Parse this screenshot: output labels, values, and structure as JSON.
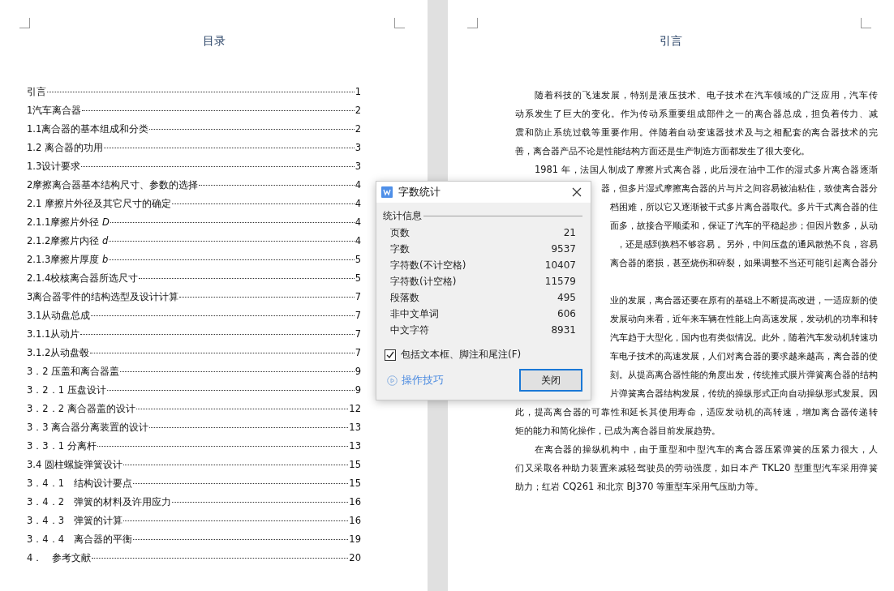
{
  "left_page": {
    "title": "目录",
    "toc": [
      {
        "title": "引言",
        "page": "1"
      },
      {
        "title": "1汽车离合器",
        "page": "2"
      },
      {
        "title": "1.1离合器的基本组成和分类",
        "page": "2"
      },
      {
        "title": "1.2 离合器的功用",
        "page": "3"
      },
      {
        "title": "1.3设计要求",
        "page": "3"
      },
      {
        "title": "2摩擦离合器基本结构尺寸、参数的选择",
        "page": "4"
      },
      {
        "title": "2.1 摩擦片外径及其它尺寸的确定",
        "page": "4"
      },
      {
        "title": "2.1.1摩擦片外径 *D*",
        "page": "4"
      },
      {
        "title": "2.1.2摩擦片内径 *d*",
        "page": "4"
      },
      {
        "title": "2.1.3摩擦片厚度 *b*",
        "page": "5"
      },
      {
        "title": "2.1.4校核离合器所选尺寸",
        "page": "5"
      },
      {
        "title": "3离合器零件的结构选型及设计计算",
        "page": "7"
      },
      {
        "title": "3.1从动盘总成",
        "page": "7"
      },
      {
        "title": "3.1.1从动片",
        "page": "7"
      },
      {
        "title": "3.1.2从动盘毂",
        "page": "7"
      },
      {
        "title": "3．2 压盖和离合器盖",
        "page": "9"
      },
      {
        "title": "3．2．1 压盘设计",
        "page": "9"
      },
      {
        "title": "3．2．2 离合器盖的设计",
        "page": "12"
      },
      {
        "title": "3．3 离合器分离装置的设计",
        "page": "13"
      },
      {
        "title": "3．3．1 分离杆",
        "page": "13"
      },
      {
        "title": "3.4 圆柱螺旋弹簧设计",
        "page": "15"
      },
      {
        "title": "3．4．1　结构设计要点",
        "page": "15"
      },
      {
        "title": "3．4．2　弹簧的材料及许用应力",
        "page": "16"
      },
      {
        "title": "3．4．3　弹簧的计算",
        "page": "16"
      },
      {
        "title": "3．4．4　离合器的平衡",
        "page": "19"
      },
      {
        "title": "4．　参考文献",
        "page": "20"
      }
    ]
  },
  "right_page": {
    "title": "引言",
    "lines": [
      {
        "kind": "indent",
        "text": "随着科技的飞速发展，特别是液压技术、电子技术在汽车领域的广泛应用，汽车传"
      },
      {
        "kind": "full",
        "text": "动系发生了巨大的变化。作为传动系重要组成部件之一的离合器总成，担负着传力、减"
      },
      {
        "kind": "full",
        "text": "震和防止系统过载等重要作用。伴随着自动变速器技术及与之相配套的离合器技术的完"
      },
      {
        "kind": "last",
        "text": "善，离合器产品不论是性能结构方面还是生产制造方面都发生了很大变化。"
      },
      {
        "kind": "indent",
        "text": "1981 年，法国人制成了摩擦片式离合器，此后浸在油中工作的湿式多片离合器逐渐"
      },
      {
        "kind": "partial",
        "text": "器，但多片湿式摩擦离合器的片与片之间容易被油粘住，致使离合器分"
      },
      {
        "kind": "partial",
        "text": "档困难，所以它又逐渐被干式多片离合器取代。多片干式离合器的住"
      },
      {
        "kind": "partial",
        "text": "面多，故接合平顺柔和，保证了汽车的平稳起步；但因片数多，从动"
      },
      {
        "kind": "partial",
        "text": "，还是感到换档不够容易 。另外，中间压盘的通风散热不良，容易"
      },
      {
        "kind": "partial",
        "text": "离合器的磨损，甚至烧伤和碎裂，如果调整不当还可能引起离合器分"
      },
      {
        "kind": "blank"
      },
      {
        "kind": "partial",
        "text": "业的发展，离合器还要在原有的基础上不断提高改进，一适应新的使"
      },
      {
        "kind": "partial",
        "text": "发展动向来看，近年来车辆在性能上向高速发展，发动机的功率和转"
      },
      {
        "kind": "partial",
        "text": "汽车趋于大型化，国内也有类似情况。此外，随着汽车发动机转速功"
      },
      {
        "kind": "partial",
        "text": "车电子技术的高速发展，人们对离合器的要求越来越高，离合器的使"
      },
      {
        "kind": "partial",
        "text": "刻。从提高离合器性能的角度出发，传统推式膜片弹簧离合器的结构"
      },
      {
        "kind": "partial",
        "text": "片弹簧离合器结构发展，传统的操纵形式正向自动操纵形式发展。因"
      },
      {
        "kind": "full",
        "text": "此，提高离合器的可靠性和延长其使用寿命，适应发动机的高转速，增加离合器传递转"
      },
      {
        "kind": "last",
        "text": "矩的能力和简化操作，已成为离合器目前发展趋势。"
      },
      {
        "kind": "indent",
        "text": "在离合器的操纵机构中，由于重型和中型汽车的离合器压紧弹簧的压紧力很大，人"
      },
      {
        "kind": "full",
        "text": "们又采取各种助力装置来减轻驾驶员的劳动强度，如日本产 TKL20 型重型汽车采用弹簧"
      },
      {
        "kind": "last",
        "text": "助力；红岩 CQ261 和北京 BJ370 等重型车采用气压助力等。"
      }
    ]
  },
  "dialog": {
    "title": "字数统计",
    "section": "统计信息",
    "stats": [
      {
        "label": "页数",
        "value": "21"
      },
      {
        "label": "字数",
        "value": "9537"
      },
      {
        "label": "字符数(不计空格)",
        "value": "10407"
      },
      {
        "label": "字符数(计空格)",
        "value": "11579"
      },
      {
        "label": "段落数",
        "value": "495"
      },
      {
        "label": "非中文单词",
        "value": "606"
      },
      {
        "label": "中文字符",
        "value": "8931"
      }
    ],
    "checkbox": {
      "label": "包括文本框、脚注和尾注(F)",
      "checked": true
    },
    "tips_link": "操作技巧",
    "close_button": "关闭"
  }
}
